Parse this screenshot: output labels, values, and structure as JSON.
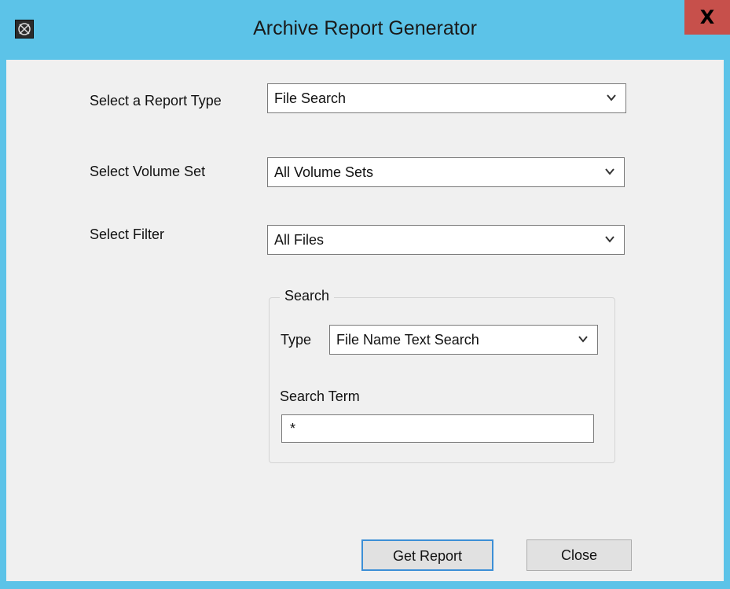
{
  "window": {
    "title": "Archive Report Generator",
    "close_label": "X"
  },
  "form": {
    "report_type_label": "Select a Report Type",
    "report_type_value": "File Search",
    "volume_set_label": "Select Volume Set",
    "volume_set_value": "All Volume Sets",
    "filter_label": "Select Filter",
    "filter_value": "All Files"
  },
  "search": {
    "group_title": "Search",
    "type_label": "Type",
    "type_value": "File Name Text Search",
    "term_label": "Search Term",
    "term_value": "*"
  },
  "buttons": {
    "get_report": "Get Report",
    "close": "Close"
  },
  "colors": {
    "titlebar": "#5cc3e8",
    "close_button": "#c7504b",
    "client_bg": "#f0f0f0",
    "focus_border": "#3c8fd6"
  },
  "icons": {
    "app": "app-icon",
    "dropdown": "chevron-down-icon"
  }
}
